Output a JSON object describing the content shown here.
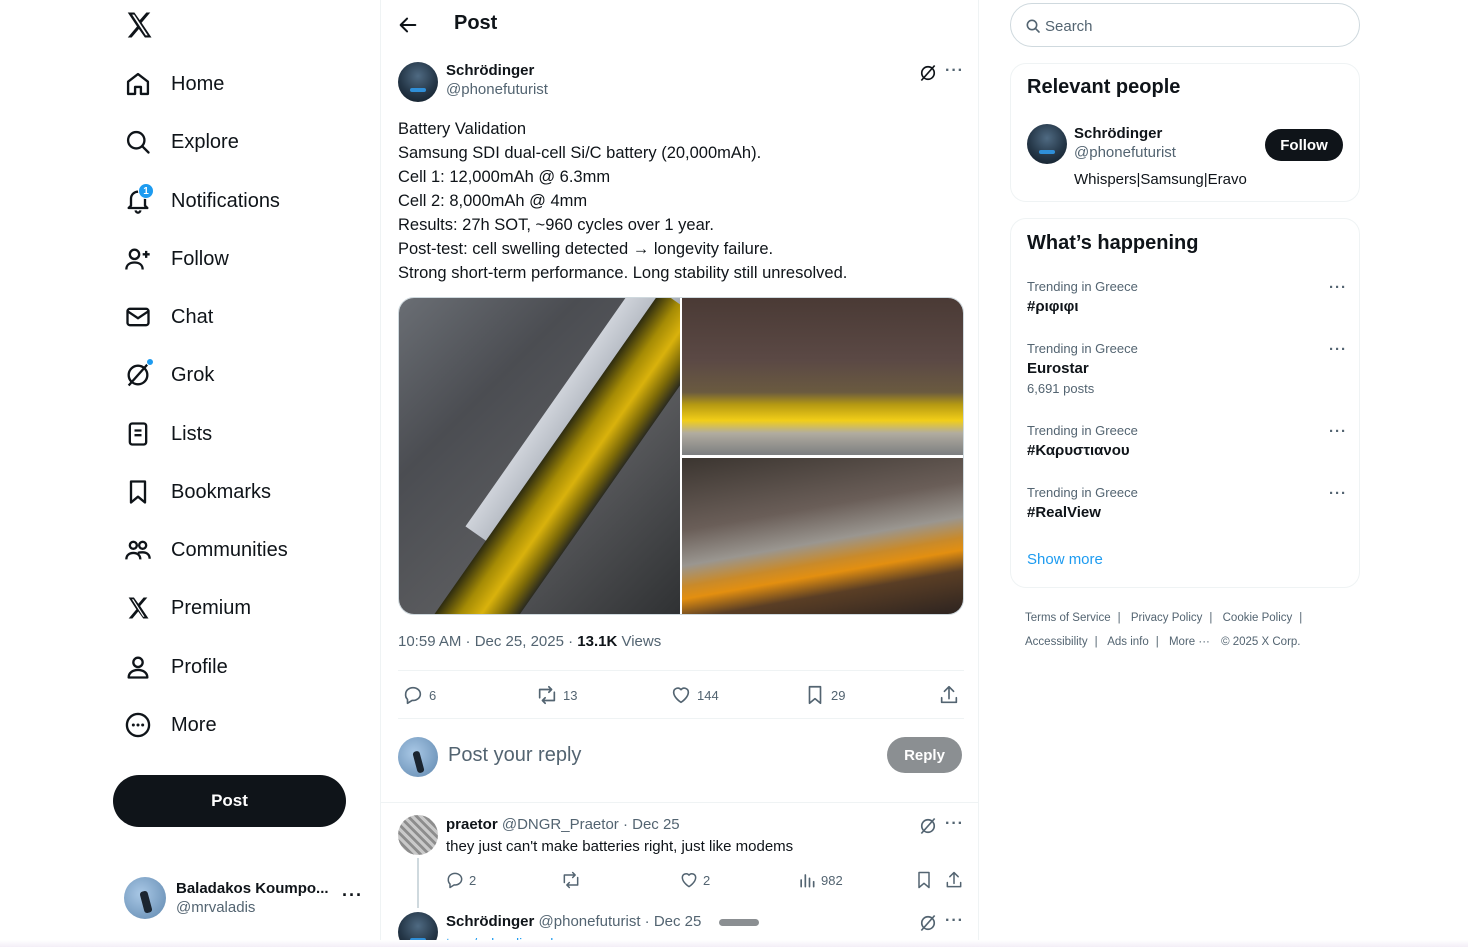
{
  "nav": {
    "items": [
      {
        "label": "Home",
        "icon": "home-icon"
      },
      {
        "label": "Explore",
        "icon": "search-icon"
      },
      {
        "label": "Notifications",
        "icon": "bell-icon",
        "badge": "1"
      },
      {
        "label": "Follow",
        "icon": "follow-icon"
      },
      {
        "label": "Chat",
        "icon": "mail-icon"
      },
      {
        "label": "Grok",
        "icon": "grok-icon"
      },
      {
        "label": "Lists",
        "icon": "lists-icon"
      },
      {
        "label": "Bookmarks",
        "icon": "bookmark-icon"
      },
      {
        "label": "Communities",
        "icon": "communities-icon"
      },
      {
        "label": "Premium",
        "icon": "x-logo-icon"
      },
      {
        "label": "Profile",
        "icon": "profile-icon"
      },
      {
        "label": "More",
        "icon": "more-circle-icon"
      }
    ],
    "post_label": "Post",
    "account": {
      "name": "Baladakos Koumpo...",
      "handle": "@mrvaladis",
      "more": "···"
    }
  },
  "header": {
    "title": "Post"
  },
  "post": {
    "author_name": "Schrödinger",
    "author_handle": "@phonefuturist",
    "lines": [
      "Battery Validation",
      "Samsung SDI dual-cell Si/C battery (20,000mAh).",
      "Cell 1: 12,000mAh @ 6.3mm",
      "Cell 2: 8,000mAh @ 4mm",
      "Results: 27h SOT, ~960 cycles over 1 year.",
      "Post-test: cell swelling detected → longevity failure.",
      "Strong short-term performance. Long stability still unresolved."
    ],
    "time": "10:59 AM · Dec 25, 2025 · ",
    "views_count": "13.1K",
    "views_label": " Views",
    "stats": {
      "replies": "6",
      "reposts": "13",
      "likes": "144",
      "bookmarks": "29"
    }
  },
  "reply": {
    "placeholder": "Post your reply",
    "button": "Reply"
  },
  "comments": [
    {
      "name": "praetor",
      "handle": "@DNGR_Praetor · Dec 25",
      "text": "they just can't make batteries right, just like modems",
      "stats": {
        "replies": "2",
        "reposts": "",
        "likes": "2",
        "views": "982"
      }
    },
    {
      "name": "Schrödinger",
      "handle": "@phonefuturist · Dec 25",
      "link": "t.me/schrodingerleo"
    }
  ],
  "search": {
    "placeholder": "Search"
  },
  "relevant": {
    "title": "Relevant people",
    "name": "Schrödinger",
    "handle": "@phonefuturist",
    "bio": "Whispers|Samsung|Eravo",
    "follow": "Follow"
  },
  "trends": {
    "title": "What’s happening",
    "items": [
      {
        "context": "Trending in Greece",
        "name": "#ριφιφι",
        "count": ""
      },
      {
        "context": "Trending in Greece",
        "name": "Eurostar",
        "count": "6,691 posts"
      },
      {
        "context": "Trending in Greece",
        "name": "#Καρυστιανου",
        "count": ""
      },
      {
        "context": "Trending in Greece",
        "name": "#RealView",
        "count": ""
      }
    ],
    "show_more": "Show more"
  },
  "footer": {
    "links": [
      "Terms of Service",
      "Privacy Policy",
      "Cookie Policy",
      "Accessibility",
      "Ads info",
      "More ···"
    ],
    "copyright": "© 2025 X Corp."
  },
  "colors": {
    "accent": "#1d9bf0",
    "text": "#0f1419",
    "muted": "#536471",
    "border": "#eff3f4"
  }
}
